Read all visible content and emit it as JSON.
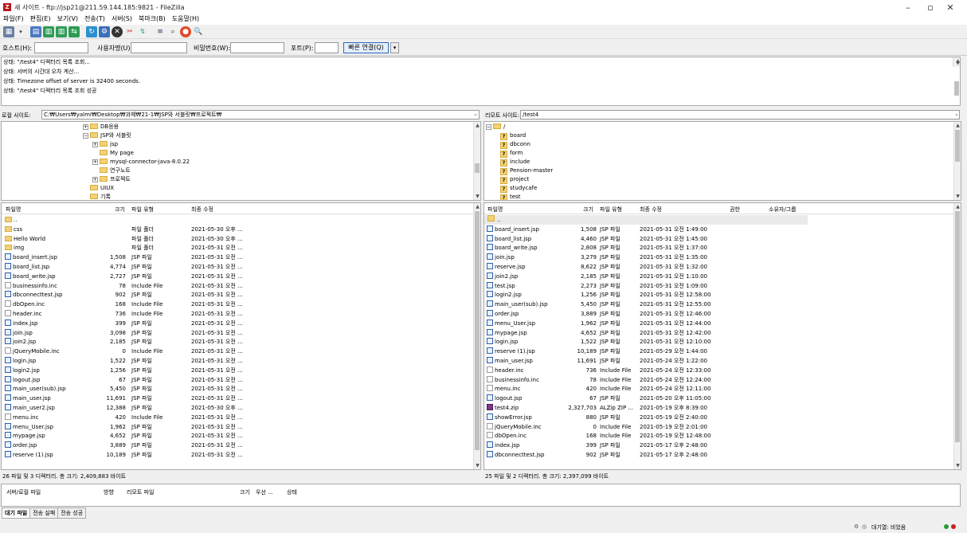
{
  "window": {
    "title": "새 사이트 - ftp://jsp21@211.59.144.185:9821 - FileZilla",
    "minimize": "–",
    "maximize": "▫",
    "close": "✕"
  },
  "menu": [
    "파일(F)",
    "편집(E)",
    "보기(V)",
    "전송(T)",
    "서버(S)",
    "북마크(B)",
    "도움말(H)"
  ],
  "quickconnect": {
    "host_label": "호스트(H):",
    "user_label": "사용자명(U):",
    "pass_label": "비밀번호(W):",
    "port_label": "포트(P):",
    "button": "빠른 연결(Q)",
    "host_value": "",
    "user_value": "",
    "pass_value": "",
    "port_value": ""
  },
  "log": [
    "상태: \"/test4\" 디렉터리 목록 조회...",
    "상태: 서버의 시간대 오차 계산...",
    "상태: Timezone offset of server is 32400 seconds.",
    "상태: \"/test4\" 디렉터리 목록 조회 성공"
  ],
  "local": {
    "site_label": "로컬 사이트:",
    "path": "C:₩Users₩yalmi₩Desktop₩과제₩21-1₩JSP와 서블릿₩프로젝트₩",
    "tree": [
      {
        "label": "DB응용",
        "expander": "+"
      },
      {
        "label": "JSP와 서블릿",
        "expander": "−"
      },
      {
        "label": "jsp",
        "expander": "+"
      },
      {
        "label": "My page",
        "expander": ""
      },
      {
        "label": "mysql-connector-java-8.0.22",
        "expander": "+"
      },
      {
        "label": "연구노트",
        "expander": ""
      },
      {
        "label": "프로젝트",
        "expander": "+"
      },
      {
        "label": "UIUX",
        "expander": ""
      },
      {
        "label": "기록",
        "expander": ""
      }
    ],
    "columns": [
      "파일명",
      "크기",
      "파일 유형",
      "최종 수정"
    ],
    "files": [
      {
        "name": "..",
        "size": "",
        "type": "",
        "modified": "",
        "icon": "folder"
      },
      {
        "name": "css",
        "size": "",
        "type": "파일 폴더",
        "modified": "2021-05-30 오후 ...",
        "icon": "folder"
      },
      {
        "name": "Hello World",
        "size": "",
        "type": "파일 폴더",
        "modified": "2021-05-30 오후 ...",
        "icon": "folder"
      },
      {
        "name": "img",
        "size": "",
        "type": "파일 폴더",
        "modified": "2021-05-31 오전 ...",
        "icon": "folder"
      },
      {
        "name": "board_insert.jsp",
        "size": "1,508",
        "type": "JSP 파일",
        "modified": "2021-05-31 오전 ...",
        "icon": "jsp"
      },
      {
        "name": "board_list.jsp",
        "size": "4,774",
        "type": "JSP 파일",
        "modified": "2021-05-31 오전 ...",
        "icon": "jsp"
      },
      {
        "name": "board_write.jsp",
        "size": "2,727",
        "type": "JSP 파일",
        "modified": "2021-05-31 오전 ...",
        "icon": "jsp"
      },
      {
        "name": "businessinfo.inc",
        "size": "78",
        "type": "Include File",
        "modified": "2021-05-31 오전 ...",
        "icon": "plain"
      },
      {
        "name": "dbconnecttest.jsp",
        "size": "902",
        "type": "JSP 파일",
        "modified": "2021-05-31 오전 ...",
        "icon": "jsp"
      },
      {
        "name": "dbOpen.inc",
        "size": "168",
        "type": "Include File",
        "modified": "2021-05-31 오전 ...",
        "icon": "plain"
      },
      {
        "name": "header.inc",
        "size": "736",
        "type": "Include File",
        "modified": "2021-05-31 오전 ...",
        "icon": "plain"
      },
      {
        "name": "index.jsp",
        "size": "399",
        "type": "JSP 파일",
        "modified": "2021-05-31 오전 ...",
        "icon": "jsp"
      },
      {
        "name": "join.jsp",
        "size": "3,098",
        "type": "JSP 파일",
        "modified": "2021-05-31 오전 ...",
        "icon": "jsp"
      },
      {
        "name": "join2.jsp",
        "size": "2,185",
        "type": "JSP 파일",
        "modified": "2021-05-31 오전 ...",
        "icon": "jsp"
      },
      {
        "name": "jQueryMobile.inc",
        "size": "0",
        "type": "Include File",
        "modified": "2021-05-31 오전 ...",
        "icon": "plain"
      },
      {
        "name": "login.jsp",
        "size": "1,522",
        "type": "JSP 파일",
        "modified": "2021-05-31 오전 ...",
        "icon": "jsp"
      },
      {
        "name": "login2.jsp",
        "size": "1,256",
        "type": "JSP 파일",
        "modified": "2021-05-31 오전 ...",
        "icon": "jsp"
      },
      {
        "name": "logout.jsp",
        "size": "67",
        "type": "JSP 파일",
        "modified": "2021-05-31 오전 ...",
        "icon": "jsp"
      },
      {
        "name": "main_user(sub).jsp",
        "size": "5,450",
        "type": "JSP 파일",
        "modified": "2021-05-31 오전 ...",
        "icon": "jsp"
      },
      {
        "name": "main_user.jsp",
        "size": "11,691",
        "type": "JSP 파일",
        "modified": "2021-05-31 오전 ...",
        "icon": "jsp"
      },
      {
        "name": "main_user2.jsp",
        "size": "12,388",
        "type": "JSP 파일",
        "modified": "2021-05-30 오후 ...",
        "icon": "jsp"
      },
      {
        "name": "menu.inc",
        "size": "420",
        "type": "Include File",
        "modified": "2021-05-31 오전 ...",
        "icon": "plain"
      },
      {
        "name": "menu_User.jsp",
        "size": "1,962",
        "type": "JSP 파일",
        "modified": "2021-05-31 오전 ...",
        "icon": "jsp"
      },
      {
        "name": "mypage.jsp",
        "size": "4,652",
        "type": "JSP 파일",
        "modified": "2021-05-31 오전 ...",
        "icon": "jsp"
      },
      {
        "name": "order.jsp",
        "size": "3,889",
        "type": "JSP 파일",
        "modified": "2021-05-31 오전 ...",
        "icon": "jsp"
      },
      {
        "name": "reserve (1).jsp",
        "size": "10,189",
        "type": "JSP 파일",
        "modified": "2021-05-31 오전 ...",
        "icon": "jsp"
      }
    ],
    "status": "26 파일 및 3 디렉터리. 총 크기: 2,409,883 바이트"
  },
  "remote": {
    "site_label": "리모트 사이트:",
    "path": "/test4",
    "tree": [
      {
        "label": "/",
        "kind": "root"
      },
      {
        "label": "board",
        "kind": "q"
      },
      {
        "label": "dbconn",
        "kind": "q"
      },
      {
        "label": "form",
        "kind": "q"
      },
      {
        "label": "include",
        "kind": "q"
      },
      {
        "label": "Pension-master",
        "kind": "q"
      },
      {
        "label": "project",
        "kind": "q"
      },
      {
        "label": "studycafe",
        "kind": "q"
      },
      {
        "label": "test",
        "kind": "q"
      }
    ],
    "columns": [
      "파일명",
      "크기",
      "파일 유형",
      "최종 수정",
      "권한",
      "소유자/그룹"
    ],
    "files": [
      {
        "name": "..",
        "size": "",
        "type": "",
        "modified": "",
        "icon": "up"
      },
      {
        "name": "board_insert.jsp",
        "size": "1,508",
        "type": "JSP 파일",
        "modified": "2021-05-31 오전 1:49:00",
        "icon": "jsp"
      },
      {
        "name": "board_list.jsp",
        "size": "4,460",
        "type": "JSP 파일",
        "modified": "2021-05-31 오전 1:45:00",
        "icon": "jsp"
      },
      {
        "name": "board_write.jsp",
        "size": "2,808",
        "type": "JSP 파일",
        "modified": "2021-05-31 오전 1:37:00",
        "icon": "jsp"
      },
      {
        "name": "join.jsp",
        "size": "3,279",
        "type": "JSP 파일",
        "modified": "2021-05-31 오전 1:35:00",
        "icon": "jsp"
      },
      {
        "name": "reserve.jsp",
        "size": "8,622",
        "type": "JSP 파일",
        "modified": "2021-05-31 오전 1:32:00",
        "icon": "jsp"
      },
      {
        "name": "join2.jsp",
        "size": "2,185",
        "type": "JSP 파일",
        "modified": "2021-05-31 오전 1:10:00",
        "icon": "jsp"
      },
      {
        "name": "test.jsp",
        "size": "2,273",
        "type": "JSP 파일",
        "modified": "2021-05-31 오전 1:09:00",
        "icon": "jsp"
      },
      {
        "name": "login2.jsp",
        "size": "1,256",
        "type": "JSP 파일",
        "modified": "2021-05-31 오전 12:58:00",
        "icon": "jsp"
      },
      {
        "name": "main_user(sub).jsp",
        "size": "5,450",
        "type": "JSP 파일",
        "modified": "2021-05-31 오전 12:55:00",
        "icon": "jsp"
      },
      {
        "name": "order.jsp",
        "size": "3,889",
        "type": "JSP 파일",
        "modified": "2021-05-31 오전 12:46:00",
        "icon": "jsp"
      },
      {
        "name": "menu_User.jsp",
        "size": "1,962",
        "type": "JSP 파일",
        "modified": "2021-05-31 오전 12:44:00",
        "icon": "jsp"
      },
      {
        "name": "mypage.jsp",
        "size": "4,652",
        "type": "JSP 파일",
        "modified": "2021-05-31 오전 12:42:00",
        "icon": "jsp"
      },
      {
        "name": "login.jsp",
        "size": "1,522",
        "type": "JSP 파일",
        "modified": "2021-05-31 오전 12:10:00",
        "icon": "jsp"
      },
      {
        "name": "reserve (1).jsp",
        "size": "10,189",
        "type": "JSP 파일",
        "modified": "2021-05-29 오전 1:44:00",
        "icon": "jsp"
      },
      {
        "name": "main_user.jsp",
        "size": "11,691",
        "type": "JSP 파일",
        "modified": "2021-05-24 오전 1:22:00",
        "icon": "jsp"
      },
      {
        "name": "header.inc",
        "size": "736",
        "type": "Include File",
        "modified": "2021-05-24 오전 12:33:00",
        "icon": "plain"
      },
      {
        "name": "businessinfo.inc",
        "size": "78",
        "type": "Include File",
        "modified": "2021-05-24 오전 12:24:00",
        "icon": "plain"
      },
      {
        "name": "menu.inc",
        "size": "420",
        "type": "Include File",
        "modified": "2021-05-24 오전 12:11:00",
        "icon": "plain"
      },
      {
        "name": "logout.jsp",
        "size": "67",
        "type": "JSP 파일",
        "modified": "2021-05-20 오후 11:05:00",
        "icon": "jsp"
      },
      {
        "name": "test4.zip",
        "size": "2,327,703",
        "type": "ALZip ZIP ...",
        "modified": "2021-05-19 오후 8:39:00",
        "icon": "zip"
      },
      {
        "name": "showError.jsp",
        "size": "880",
        "type": "JSP 파일",
        "modified": "2021-05-19 오전 2:40:00",
        "icon": "jsp"
      },
      {
        "name": "jQueryMobile.inc",
        "size": "0",
        "type": "Include File",
        "modified": "2021-05-19 오전 2:01:00",
        "icon": "plain"
      },
      {
        "name": "dbOpen.inc",
        "size": "168",
        "type": "Include File",
        "modified": "2021-05-19 오전 12:48:00",
        "icon": "plain"
      },
      {
        "name": "index.jsp",
        "size": "399",
        "type": "JSP 파일",
        "modified": "2021-05-17 오후 2:48:00",
        "icon": "jsp"
      },
      {
        "name": "dbconnecttest.jsp",
        "size": "902",
        "type": "JSP 파일",
        "modified": "2021-05-17 오후 2:48:00",
        "icon": "jsp"
      }
    ],
    "status": "25 파일 및 2 디렉터리. 총 크기: 2,397,099 바이트"
  },
  "queue": {
    "columns": [
      "서버/로컬 파일",
      "방향",
      "리모트 파일",
      "크기",
      "우선 ...",
      "상태"
    ],
    "tabs": [
      "대기 파일",
      "전송 실패",
      "전송 성공"
    ]
  },
  "statusbar": {
    "queue_text": "대기열: 비었음"
  },
  "colors": {
    "accent": "#2a66c2",
    "folder": "#f2d275",
    "app_icon": "#b3161b"
  }
}
